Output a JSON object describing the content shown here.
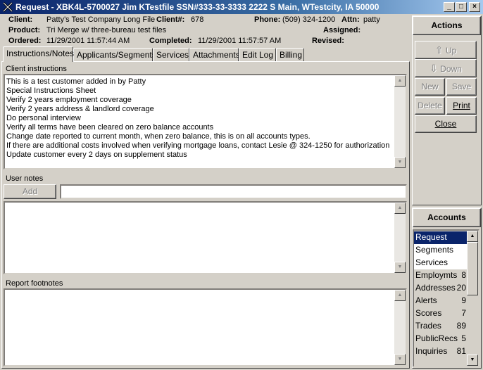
{
  "window": {
    "title": "Request - XBK4L-5700027  Jim KTestfile  SSN#333-33-3333  2222 S Main, WTestcity, IA 50000",
    "minimize": "_",
    "maximize": "□",
    "close": "×"
  },
  "header": {
    "client_label": "Client:",
    "client_value": "Patty's Test Company Long File",
    "client_num_label": "Client#:",
    "client_num_value": "678",
    "phone_label": "Phone:",
    "phone_value": "(509) 324-1200",
    "attn_label": "Attn:",
    "attn_value": "patty",
    "product_label": "Product:",
    "product_value": "Tri Merge w/ three-bureau test files",
    "assigned_label": "Assigned:",
    "ordered_label": "Ordered:",
    "ordered_value": "11/29/2001 11:57:44 AM",
    "completed_label": "Completed:",
    "completed_value": "11/29/2001 11:57:57 AM",
    "revised_label": "Revised:"
  },
  "tabs": [
    {
      "label": "Instructions/Notes"
    },
    {
      "label": "Applicants/Segments"
    },
    {
      "label": "Services"
    },
    {
      "label": "Attachments"
    },
    {
      "label": "Edit Log"
    },
    {
      "label": "Billing"
    }
  ],
  "client_instructions": {
    "label": "Client instructions",
    "lines": [
      "This is a test customer added in by Patty",
      "Special Instructions Sheet",
      "Verify 2 years employment coverage",
      "Verify 2 years address & landlord coverage",
      "Do personal interview",
      "Verify all terms have been cleared on zero balance accounts",
      "Change date reported to current month, when zero balance, this is on all accounts types.",
      "If there are additional costs involved when verifying mortgage loans, contact Lesie @ 324-1250 for authorization",
      "Update customer every 2 days on supplement status"
    ]
  },
  "user_notes": {
    "label": "User notes",
    "add_label": "Add",
    "input_value": ""
  },
  "report_footnotes": {
    "label": "Report footnotes"
  },
  "actions": {
    "header": "Actions",
    "up": "Up",
    "down": "Down",
    "new": "New",
    "save": "Save",
    "delete": "Delete",
    "print": "Print",
    "close": "Close"
  },
  "accounts": {
    "header": "Accounts",
    "items": [
      {
        "label": "Request",
        "count": ""
      },
      {
        "label": "Segments",
        "count": ""
      },
      {
        "label": "Services",
        "count": ""
      },
      {
        "label": "Employmts",
        "count": "8"
      },
      {
        "label": "Addresses",
        "count": "20"
      },
      {
        "label": "Alerts",
        "count": "9"
      },
      {
        "label": "Scores",
        "count": "7"
      },
      {
        "label": "Trades",
        "count": "89"
      },
      {
        "label": "PublicRecs",
        "count": "5"
      },
      {
        "label": "Inquiries",
        "count": "81"
      }
    ]
  }
}
